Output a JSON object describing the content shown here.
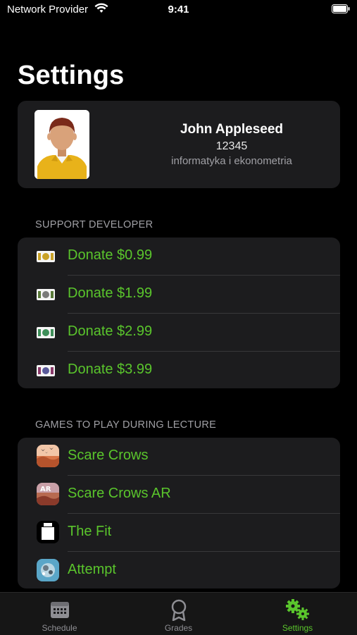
{
  "status_bar": {
    "carrier": "Network Provider",
    "time": "9:41"
  },
  "page": {
    "title": "Settings"
  },
  "profile": {
    "name": "John Appleseed",
    "id": "12345",
    "field": "informatyka i ekonometria"
  },
  "support": {
    "header": "SUPPORT DEVELOPER",
    "items": [
      {
        "label": "Donate $0.99",
        "icon": "banknote-icon",
        "color": "#c9a227"
      },
      {
        "label": "Donate $1.99",
        "icon": "banknote-icon",
        "color": "#5a7a3a"
      },
      {
        "label": "Donate $2.99",
        "icon": "banknote-icon",
        "color": "#3f8f5a"
      },
      {
        "label": "Donate $3.99",
        "icon": "banknote-icon",
        "color": "#8a3a6a"
      }
    ]
  },
  "games": {
    "header": "GAMES TO PLAY DURING LECTURE",
    "items": [
      {
        "label": "Scare Crows",
        "icon": "scare-crows-app-icon"
      },
      {
        "label": "Scare Crows AR",
        "icon": "scare-crows-ar-app-icon"
      },
      {
        "label": "The Fit",
        "icon": "the-fit-app-icon"
      },
      {
        "label": "Attempt",
        "icon": "attempt-app-icon"
      }
    ]
  },
  "tab_bar": {
    "tabs": [
      {
        "label": "Schedule",
        "icon": "calendar-icon",
        "active": false
      },
      {
        "label": "Grades",
        "icon": "award-ribbon-icon",
        "active": false
      },
      {
        "label": "Settings",
        "icon": "gears-icon",
        "active": true
      }
    ]
  },
  "colors": {
    "accent": "#5ac52c",
    "background": "#000000",
    "card": "#1c1c1e",
    "secondary_text": "#a0a0a5"
  }
}
